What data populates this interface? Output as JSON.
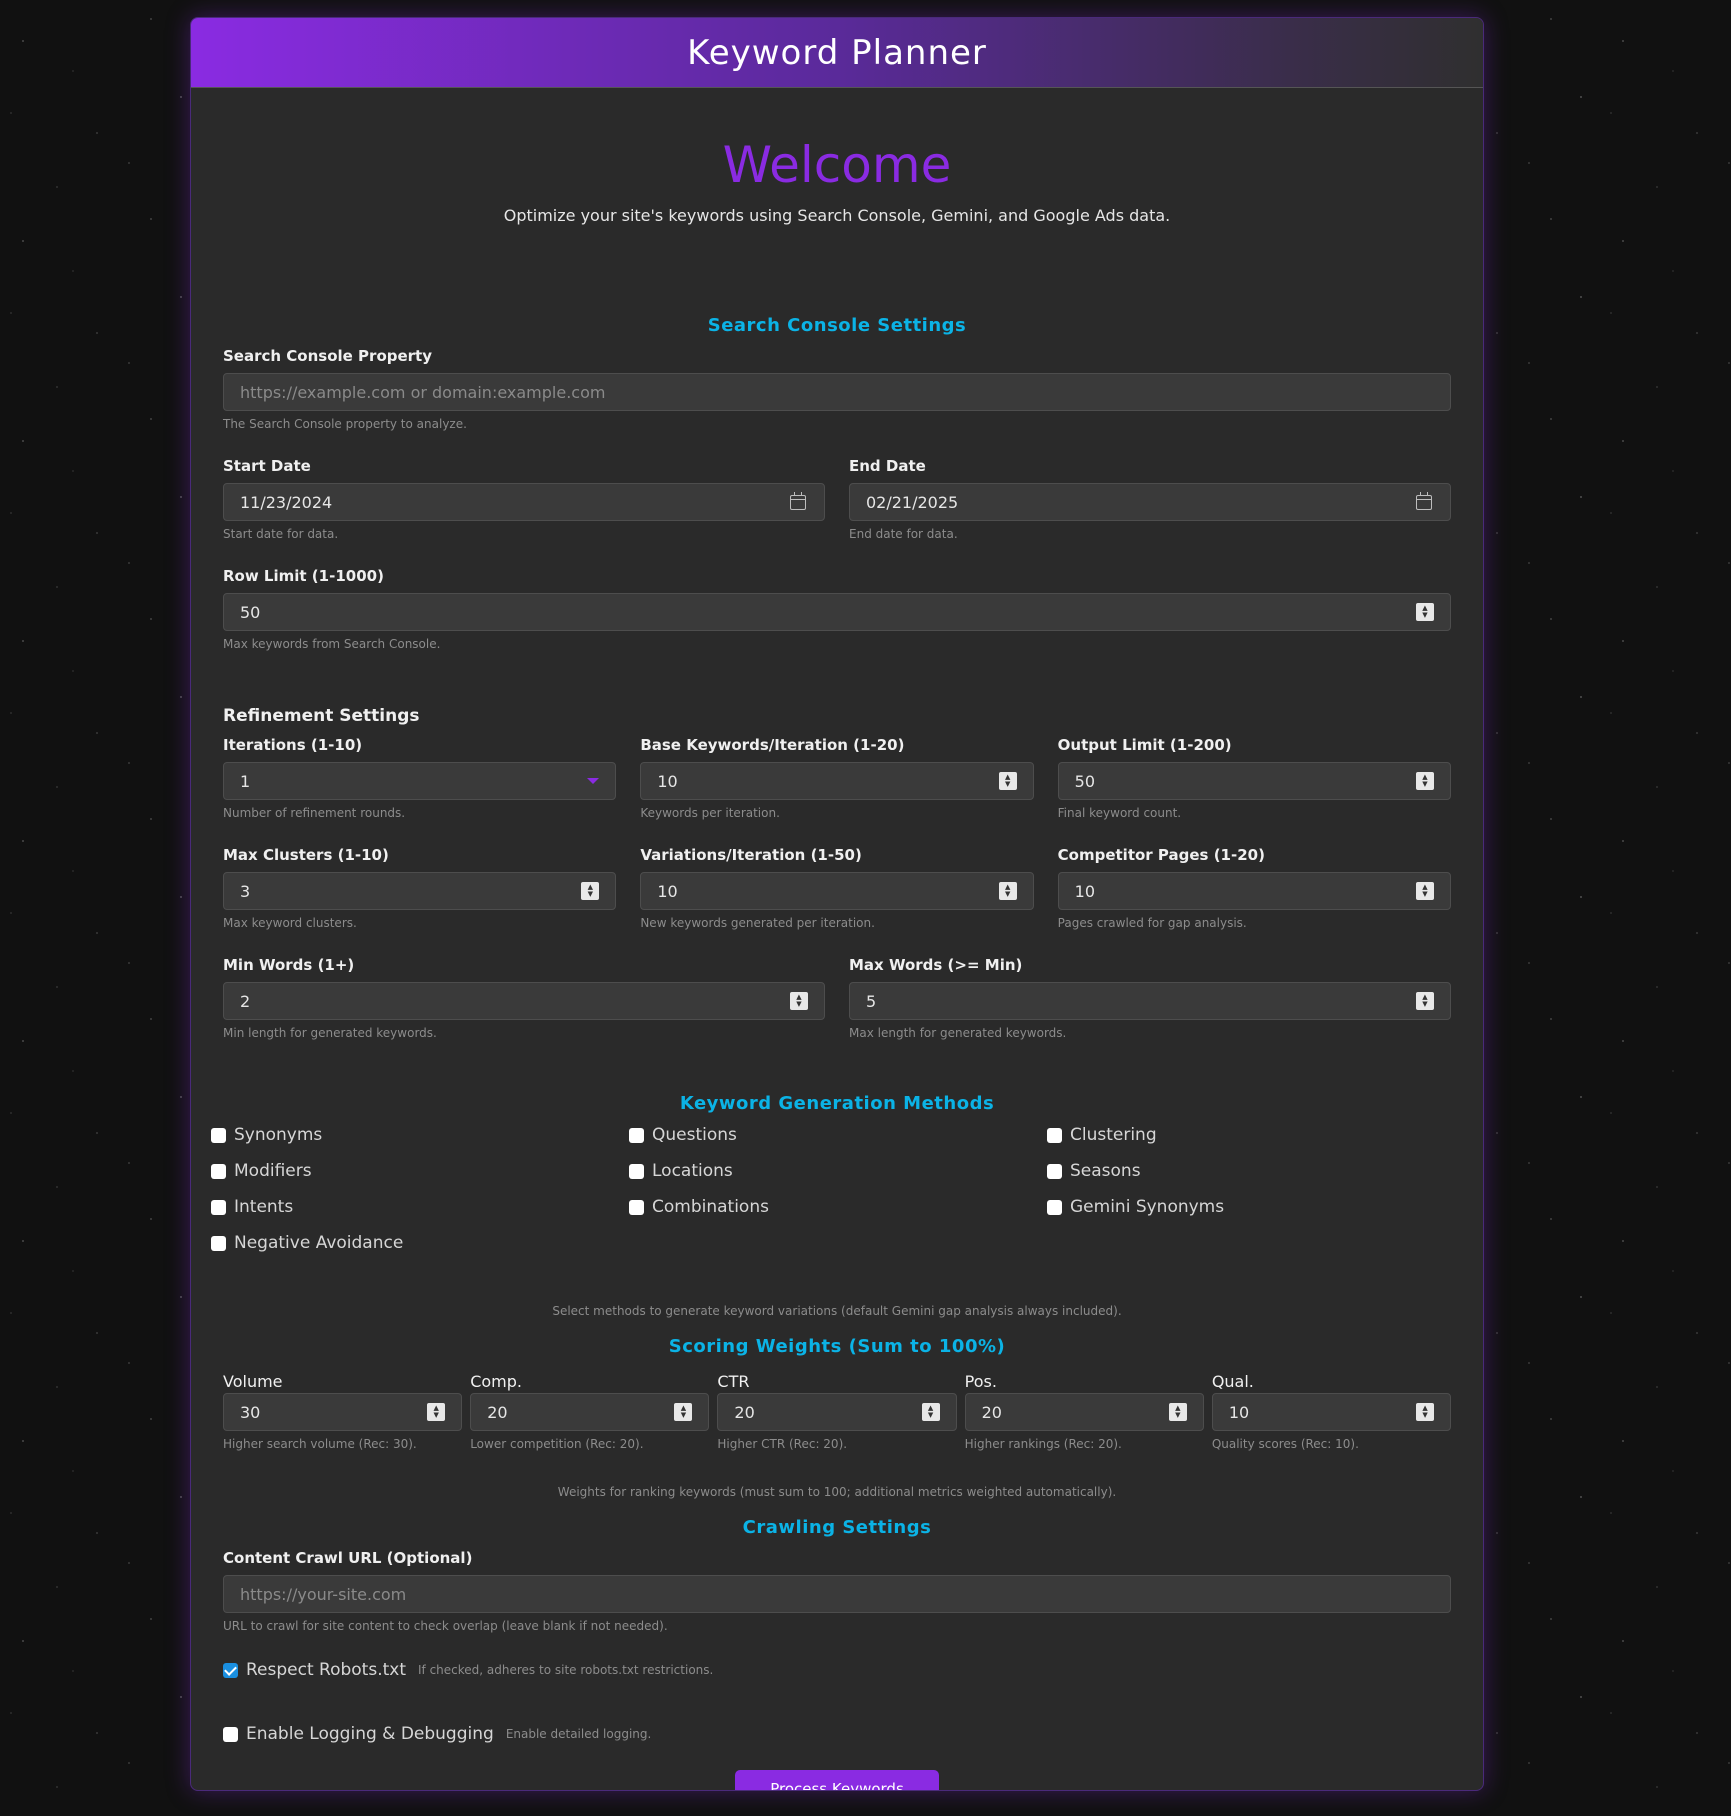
{
  "header": {
    "title": "Keyword Planner"
  },
  "welcome": {
    "heading": "Welcome",
    "intro": "Optimize your site's keywords using Search Console, Gemini, and Google Ads data."
  },
  "search_console": {
    "title": "Search Console Settings",
    "property": {
      "label": "Search Console Property",
      "placeholder": "https://example.com or domain:example.com",
      "help": "The Search Console property to analyze."
    },
    "start_date": {
      "label": "Start Date",
      "value": "11/23/2024",
      "help": "Start date for data."
    },
    "end_date": {
      "label": "End Date",
      "value": "02/21/2025",
      "help": "End date for data."
    },
    "row_limit": {
      "label": "Row Limit (1-1000)",
      "value": "50",
      "help": "Max keywords from Search Console."
    }
  },
  "refinement": {
    "title": "Refinement Settings",
    "iterations": {
      "label": "Iterations (1-10)",
      "value": "1",
      "help": "Number of refinement rounds."
    },
    "base_keywords": {
      "label": "Base Keywords/Iteration (1-20)",
      "value": "10",
      "help": "Keywords per iteration."
    },
    "output_limit": {
      "label": "Output Limit (1-200)",
      "value": "50",
      "help": "Final keyword count."
    },
    "max_clusters": {
      "label": "Max Clusters (1-10)",
      "value": "3",
      "help": "Max keyword clusters."
    },
    "variations": {
      "label": "Variations/Iteration (1-50)",
      "value": "10",
      "help": "New keywords generated per iteration."
    },
    "competitor_pages": {
      "label": "Competitor Pages (1-20)",
      "value": "10",
      "help": "Pages crawled for gap analysis."
    },
    "min_words": {
      "label": "Min Words (1+)",
      "value": "2",
      "help": "Min length for generated keywords."
    },
    "max_words": {
      "label": "Max Words (>= Min)",
      "value": "5",
      "help": "Max length for generated keywords."
    }
  },
  "methods": {
    "title": "Keyword Generation Methods",
    "items": [
      {
        "label": "Synonyms",
        "checked": false
      },
      {
        "label": "Questions",
        "checked": false
      },
      {
        "label": "Clustering",
        "checked": false
      },
      {
        "label": "Modifiers",
        "checked": false
      },
      {
        "label": "Locations",
        "checked": false
      },
      {
        "label": "Seasons",
        "checked": false
      },
      {
        "label": "Intents",
        "checked": false
      },
      {
        "label": "Combinations",
        "checked": false
      },
      {
        "label": "Gemini Synonyms",
        "checked": false
      },
      {
        "label": "Negative Avoidance",
        "checked": false
      }
    ],
    "help": "Select methods to generate keyword variations (default Gemini gap analysis always included)."
  },
  "weights": {
    "title": "Scoring Weights (Sum to 100%)",
    "items": [
      {
        "label": "Volume",
        "value": "30",
        "help": "Higher search volume (Rec: 30)."
      },
      {
        "label": "Comp.",
        "value": "20",
        "help": "Lower competition (Rec: 20)."
      },
      {
        "label": "CTR",
        "value": "20",
        "help": "Higher CTR (Rec: 20)."
      },
      {
        "label": "Pos.",
        "value": "20",
        "help": "Higher rankings (Rec: 20)."
      },
      {
        "label": "Qual.",
        "value": "10",
        "help": "Quality scores (Rec: 10)."
      }
    ],
    "help": "Weights for ranking keywords (must sum to 100; additional metrics weighted automatically)."
  },
  "crawling": {
    "title": "Crawling Settings",
    "url": {
      "label": "Content Crawl URL (Optional)",
      "placeholder": "https://your-site.com",
      "help": "URL to crawl for site content to check overlap (leave blank if not needed)."
    },
    "robots": {
      "label": "Respect Robots.txt",
      "help": "If checked, adheres to site robots.txt restrictions.",
      "checked": true
    },
    "logging": {
      "label": "Enable Logging & Debugging",
      "help": "Enable detailed logging.",
      "checked": false
    }
  },
  "submit": {
    "label": "Process Keywords"
  },
  "colors": {
    "accent": "#8a2be2",
    "section_title": "#0bb3e6",
    "checkbox_checked": "#1a8fe0"
  }
}
